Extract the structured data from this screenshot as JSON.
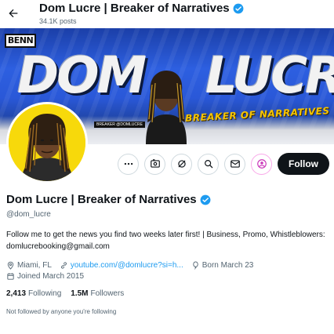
{
  "header": {
    "title": "Dom Lucre | Breaker of Narratives",
    "posts_count": "34.1K posts"
  },
  "banner": {
    "logo_text": "BENN",
    "headline_left": "DOM",
    "headline_right": "LUCRE",
    "tagline": "BREAKER OF NARRATIVES",
    "small_caption": "BREAKER @DOMLUCRE"
  },
  "actions": {
    "follow_label": "Follow",
    "icons": [
      "more-icon",
      "grok-icon",
      "ai-icon",
      "search-icon",
      "message-icon",
      "subscribe-icon"
    ]
  },
  "profile": {
    "display_name": "Dom Lucre | Breaker of Narratives",
    "handle": "@dom_lucre",
    "bio": "Follow me to get the news you find two weeks later first! | Business, Promo, Whistleblowers: domlucrebooking@gmail.com",
    "location": "Miami, FL",
    "link": "youtube.com/@domlucre?si=h...",
    "born": "Born March 23",
    "joined": "Joined March 2015",
    "following_count": "2,413",
    "following_label": "Following",
    "followers_count": "1.5M",
    "followers_label": "Followers",
    "not_followed_text": "Not followed by anyone you're following"
  },
  "colors": {
    "accent": "#1d9bf0",
    "follow_button": "#0f1419",
    "banner_blue": "#2d5fe0",
    "avatar_bg": "#f7d90b",
    "tagline_yellow": "#f5c400"
  }
}
